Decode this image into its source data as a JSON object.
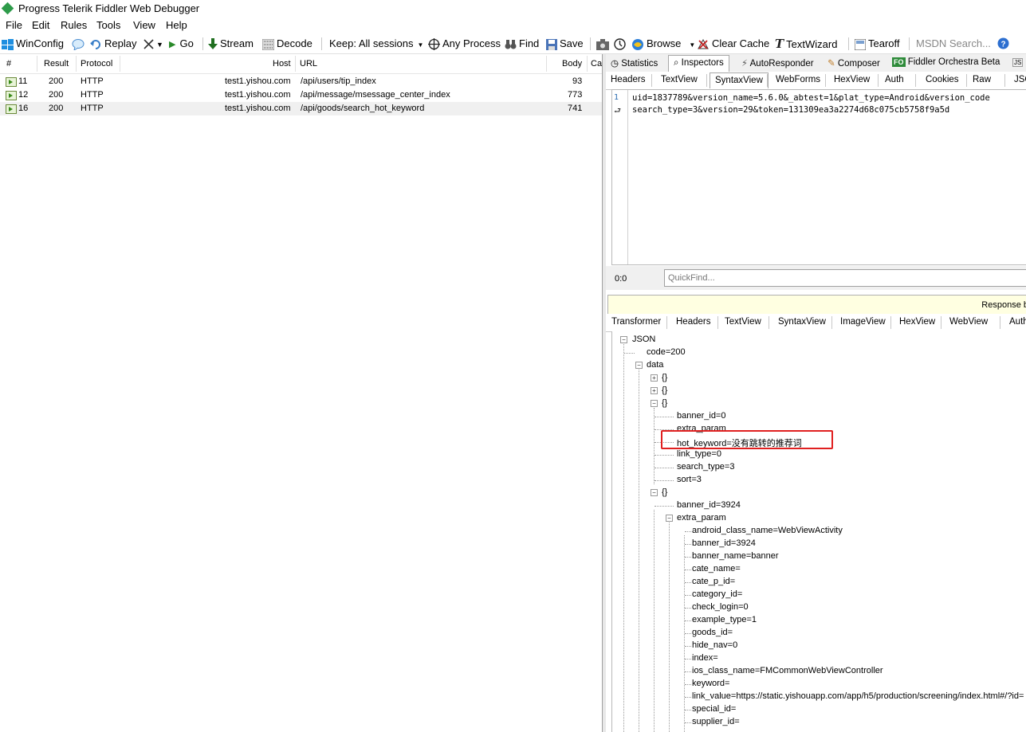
{
  "window": {
    "title": "Progress Telerik Fiddler Web Debugger"
  },
  "menu": [
    "File",
    "Edit",
    "Rules",
    "Tools",
    "View",
    "Help"
  ],
  "toolbar": {
    "winconfig": "WinConfig",
    "replay": "Replay",
    "go": "Go",
    "stream": "Stream",
    "decode": "Decode",
    "keep": "Keep: All sessions",
    "process": "Any Process",
    "find": "Find",
    "save": "Save",
    "browse": "Browse",
    "clear_cache": "Clear Cache",
    "textwizard": "TextWizard",
    "tearoff": "Tearoff",
    "search_placeholder": "MSDN Search..."
  },
  "sessions": {
    "columns": [
      "#",
      "Result",
      "Protocol",
      "Host",
      "URL",
      "Body",
      "Ca"
    ],
    "rows": [
      {
        "id": "11",
        "result": "200",
        "protocol": "HTTP",
        "host": "test1.yishou.com",
        "url": "/api/users/tip_index",
        "body": "93"
      },
      {
        "id": "12",
        "result": "200",
        "protocol": "HTTP",
        "host": "test1.yishou.com",
        "url": "/api/message/msessage_center_index",
        "body": "773"
      },
      {
        "id": "16",
        "result": "200",
        "protocol": "HTTP",
        "host": "test1.yishou.com",
        "url": "/api/goods/search_hot_keyword",
        "body": "741"
      }
    ]
  },
  "inspector_tabs": [
    "Statistics",
    "Inspectors",
    "AutoResponder",
    "Composer",
    "Fiddler Orchestra Beta",
    "F"
  ],
  "request_tabs": [
    "Headers",
    "TextView",
    "SyntaxView",
    "WebForms",
    "HexView",
    "Auth",
    "Cookies",
    "Raw",
    "JSO"
  ],
  "request_body": {
    "line_numbers": [
      "1"
    ],
    "lines": [
      "uid=1837789&version_name=5.6.0&_abtest=1&plat_type=Android&version_code",
      "search_type=3&version=29&token=131309ea3a2274d68c075cb5758f9a5d"
    ]
  },
  "quickfind": {
    "position": "0:0",
    "placeholder": "QuickFind..."
  },
  "response_bar": "Response b",
  "response_tabs": [
    "Transformer",
    "Headers",
    "TextView",
    "SyntaxView",
    "ImageView",
    "HexView",
    "WebView",
    "Auth"
  ],
  "json_tree": {
    "root": "JSON",
    "code": "code=200",
    "data": "data",
    "obj": "{}",
    "item3": [
      "banner_id=0",
      "extra_param",
      "hot_keyword=没有跳转的推荐词",
      "link_type=0",
      "search_type=3",
      "sort=3"
    ],
    "item4_banner": "banner_id=3924",
    "item4_extra": "extra_param",
    "extra_fields": [
      "android_class_name=WebViewActivity",
      "banner_id=3924",
      "banner_name=banner",
      "cate_name=",
      "cate_p_id=",
      "category_id=",
      "check_login=0",
      "example_type=1",
      "goods_id=",
      "hide_nav=0",
      "index=",
      "ios_class_name=FMCommonWebViewController",
      "keyword=",
      "link_value=https://static.yishouapp.com/app/h5/production/screening/index.html#/?id=",
      "special_id=",
      "supplier_id="
    ]
  }
}
